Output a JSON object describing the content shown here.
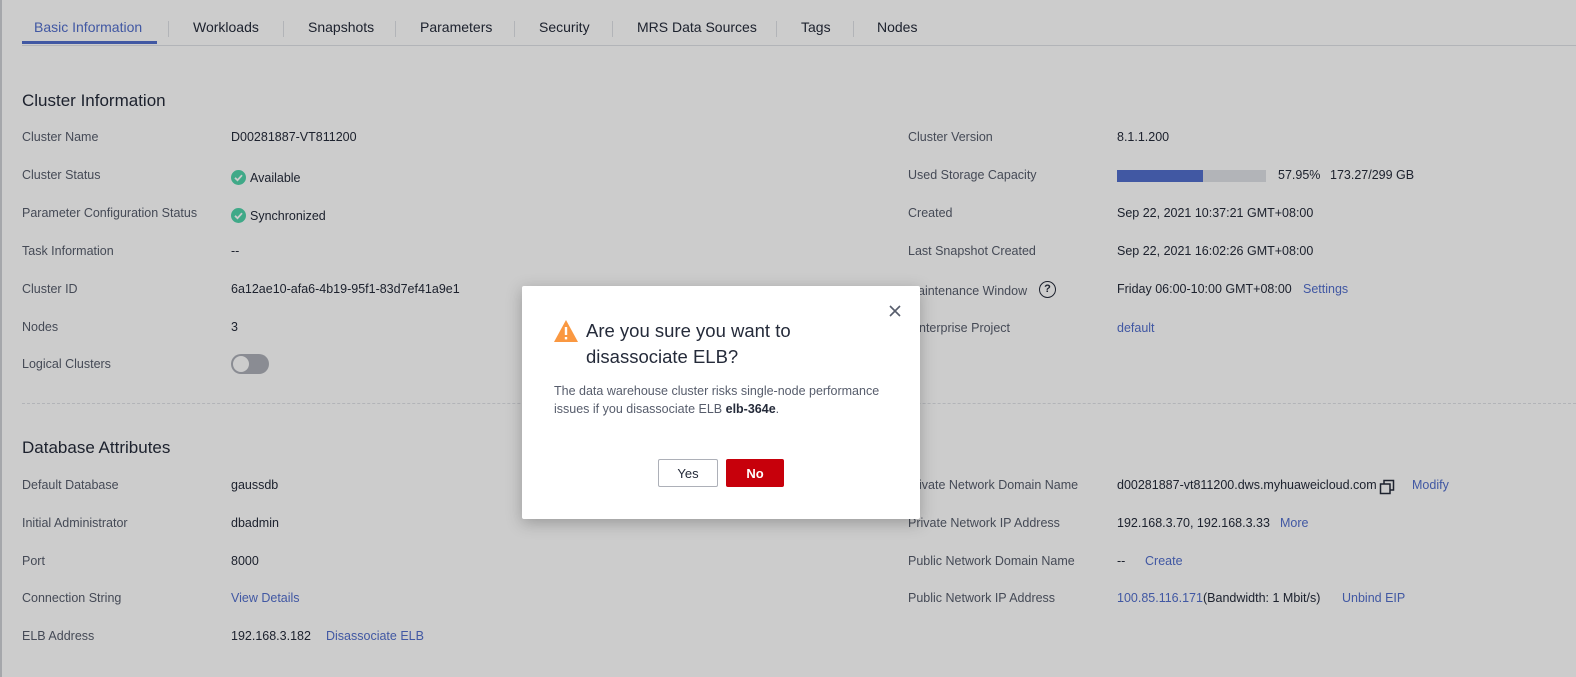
{
  "tabs": [
    {
      "label": "Basic Information",
      "active": true
    },
    {
      "label": "Workloads"
    },
    {
      "label": "Snapshots"
    },
    {
      "label": "Parameters"
    },
    {
      "label": "Security"
    },
    {
      "label": "MRS Data Sources"
    },
    {
      "label": "Tags"
    },
    {
      "label": "Nodes"
    }
  ],
  "cluster_info": {
    "title": "Cluster Information",
    "cluster_name_label": "Cluster Name",
    "cluster_name": "D00281887-VT811200",
    "cluster_status_label": "Cluster Status",
    "cluster_status": "Available",
    "param_status_label": "Parameter Configuration Status",
    "param_status": "Synchronized",
    "task_info_label": "Task Information",
    "task_info": "--",
    "cluster_id_label": "Cluster ID",
    "cluster_id": "6a12ae10-afa6-4b19-95f1-83d7ef41a9e1",
    "nodes_label": "Nodes",
    "nodes": "3",
    "logical_clusters_label": "Logical Clusters",
    "logical_clusters_enabled": false,
    "cluster_version_label": "Cluster Version",
    "cluster_version": "8.1.1.200",
    "used_storage_label": "Used Storage Capacity",
    "used_storage_fraction": 0.5795,
    "used_storage_percent": "57.95%",
    "used_storage_amount": "173.27/299 GB",
    "created_label": "Created",
    "created": "Sep 22, 2021 10:37:21 GMT+08:00",
    "last_snapshot_label": "Last Snapshot Created",
    "last_snapshot": "Sep 22, 2021 16:02:26 GMT+08:00",
    "maintenance_label": "aintenance Window",
    "maintenance": "Friday 06:00-10:00 GMT+08:00",
    "settings_link": "Settings",
    "enterprise_label": "nterprise Project",
    "enterprise": "default"
  },
  "db_attrs": {
    "title": "Database Attributes",
    "default_db_label": "Default Database",
    "default_db": "gaussdb",
    "admin_label": "Initial Administrator",
    "admin": "dbadmin",
    "port_label": "Port",
    "port": "8000",
    "conn_label": "Connection String",
    "conn_link": "View Details",
    "elb_label": "ELB Address",
    "elb": "192.168.3.182",
    "elb_link": "Disassociate ELB",
    "priv_domain_label": "ivate Network Domain Name",
    "priv_domain": "d00281887-vt811200.dws.myhuaweicloud.com",
    "priv_domain_link": "Modify",
    "priv_ip_label": "Private Network IP Address",
    "priv_ip": "192.168.3.70, 192.168.3.33",
    "priv_ip_link": "More",
    "pub_domain_label": "Public Network Domain Name",
    "pub_domain": "--",
    "pub_domain_link": "Create",
    "pub_ip_label": "Public Network IP Address",
    "pub_ip": "100.85.116.171",
    "pub_ip_bw": "(Bandwidth: 1 Mbit/s)",
    "pub_ip_link": "Unbind EIP"
  },
  "dialog": {
    "title": "Are you sure you want to disassociate ELB?",
    "message_prefix": "The data warehouse cluster risks single-node performance issues if you disassociate ELB ",
    "message_bold": "elb-364e",
    "message_suffix": ".",
    "yes_label": "Yes",
    "no_label": "No"
  },
  "colors": {
    "accent": "#526ecc",
    "success": "#50d4ab",
    "danger": "#c7000b",
    "warning": "#fa9841"
  }
}
